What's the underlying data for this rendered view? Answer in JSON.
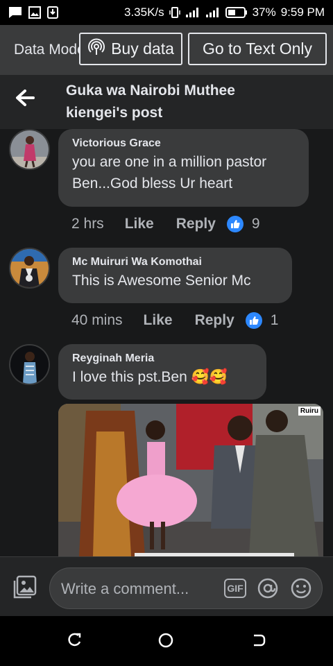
{
  "status_bar": {
    "speed": "3.35K/s",
    "battery": "37%",
    "time": "9:59 PM"
  },
  "banner": {
    "data_mode": "Data Mode",
    "buy_data": "Buy data",
    "text_only": "Go to Text Only"
  },
  "header": {
    "title": "Guka wa Nairobi Muthee kiengei's post"
  },
  "comments": [
    {
      "author": "Victorious Grace",
      "text": "you are one in a million pastor Ben...God bless Ur heart",
      "time": "2 hrs",
      "like": "Like",
      "reply": "Reply",
      "likes": "9"
    },
    {
      "author": "Mc Muiruri Wa Komothai",
      "text": "This is Awesome Senior Mc",
      "time": "40 mins",
      "like": "Like",
      "reply": "Reply",
      "likes": "1"
    },
    {
      "author": "Reyginah Meria",
      "text": "I love this pst.Ben 🥰🥰",
      "image_tag": "Ruiru"
    }
  ],
  "composer": {
    "placeholder": "Write a comment...",
    "gif": "GIF"
  },
  "colors": {
    "background": "#18191a",
    "bubble": "#3a3b3c",
    "like_blue": "#2d88ff"
  }
}
